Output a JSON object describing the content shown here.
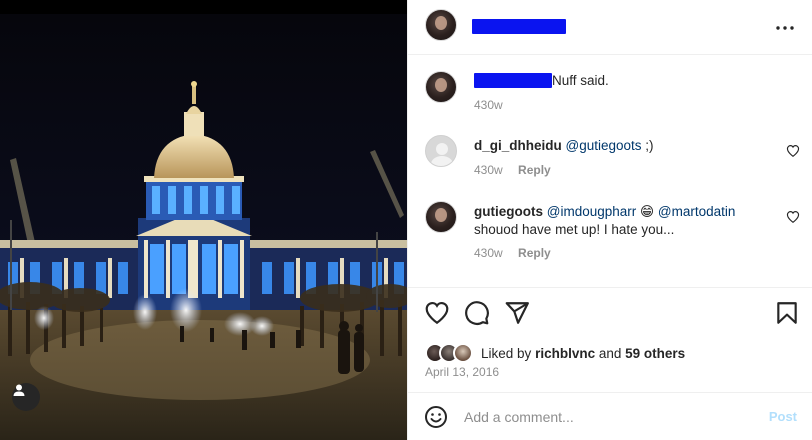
{
  "post": {
    "caption": {
      "text": "Nuff said.",
      "time": "430w"
    },
    "comments": [
      {
        "username": "d_gi_dhheidu",
        "mention": "@gutiegoots",
        "text": " ;)",
        "time": "430w",
        "reply_label": "Reply"
      },
      {
        "username": "gutiegoots",
        "mention": "@imdougpharr",
        "emoji": "😁",
        "mention2": "@martodatin",
        "text": "shouod have met up! I hate you...",
        "time": "430w",
        "reply_label": "Reply"
      }
    ],
    "likes": {
      "prefix": "Liked by",
      "liker": "richblvnc",
      "conjunction": "and",
      "others": "59 others"
    },
    "date": "April 13, 2016"
  },
  "composer": {
    "placeholder": "Add a comment...",
    "post_label": "Post"
  },
  "icons": {
    "more": "more-horizontal-icon",
    "like": "heart-icon",
    "comment": "comment-bubble-icon",
    "share": "paper-plane-icon",
    "save": "bookmark-icon",
    "emoji": "emoji-smile-icon",
    "user_tag": "user-tag-icon"
  },
  "colors": {
    "mention": "#00376b",
    "redaction": "#0a14f0",
    "post_disabled": "#b2dffc",
    "meta_gray": "#8e8e8e"
  }
}
